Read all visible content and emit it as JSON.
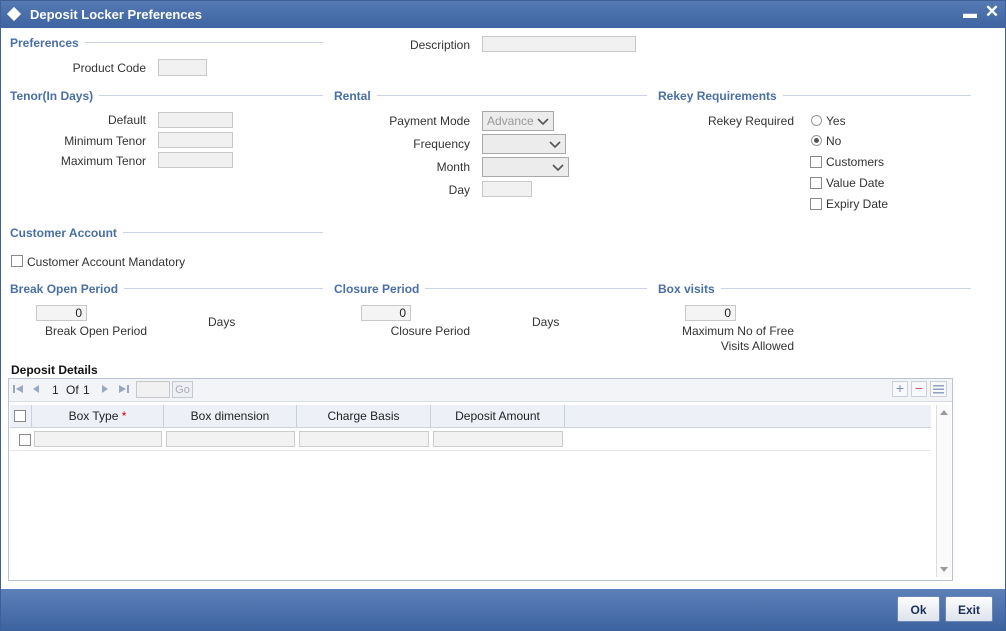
{
  "window": {
    "title": "Deposit Locker Preferences"
  },
  "preferences": {
    "section_title": "Preferences",
    "product_code_label": "Product Code",
    "product_code_value": "",
    "description_label": "Description",
    "description_value": ""
  },
  "tenor": {
    "section_title": "Tenor(In Days)",
    "default_label": "Default",
    "minimum_label": "Minimum Tenor",
    "maximum_label": "Maximum Tenor",
    "default_value": "",
    "minimum_value": "",
    "maximum_value": ""
  },
  "rental": {
    "section_title": "Rental",
    "payment_mode_label": "Payment Mode",
    "payment_mode_value": "Advance",
    "frequency_label": "Frequency",
    "frequency_value": "",
    "month_label": "Month",
    "month_value": "",
    "day_label": "Day",
    "day_value": ""
  },
  "rekey": {
    "section_title": "Rekey Requirements",
    "rekey_required_label": "Rekey Required",
    "yes_label": "Yes",
    "no_label": "No",
    "selected": "No",
    "customers_label": "Customers",
    "value_date_label": "Value Date",
    "expiry_date_label": "Expiry Date"
  },
  "customer_account": {
    "section_title": "Customer Account",
    "mandatory_label": "Customer Account Mandatory"
  },
  "break_open": {
    "section_title": "Break Open Period",
    "value": "0",
    "label": "Break Open Period",
    "unit": "Days"
  },
  "closure": {
    "section_title": "Closure Period",
    "value": "0",
    "label": "Closure Period",
    "unit": "Days"
  },
  "box_visits": {
    "section_title": "Box visits",
    "value": "0",
    "label_line1": "Maximum No of Free",
    "label_line2": "Visits Allowed"
  },
  "deposit_details": {
    "title": "Deposit Details",
    "pager": {
      "current": "1",
      "of_label": "Of",
      "total": "1",
      "go_label": "Go"
    },
    "columns": [
      "Box Type",
      "Box dimension",
      "Charge Basis",
      "Deposit Amount"
    ],
    "required_marker": "*"
  },
  "footer": {
    "ok_label": "Ok",
    "exit_label": "Exit"
  },
  "colors": {
    "title_bar": "#3e64a1",
    "section_title": "#4a6fa5",
    "required": "#cc0000"
  }
}
